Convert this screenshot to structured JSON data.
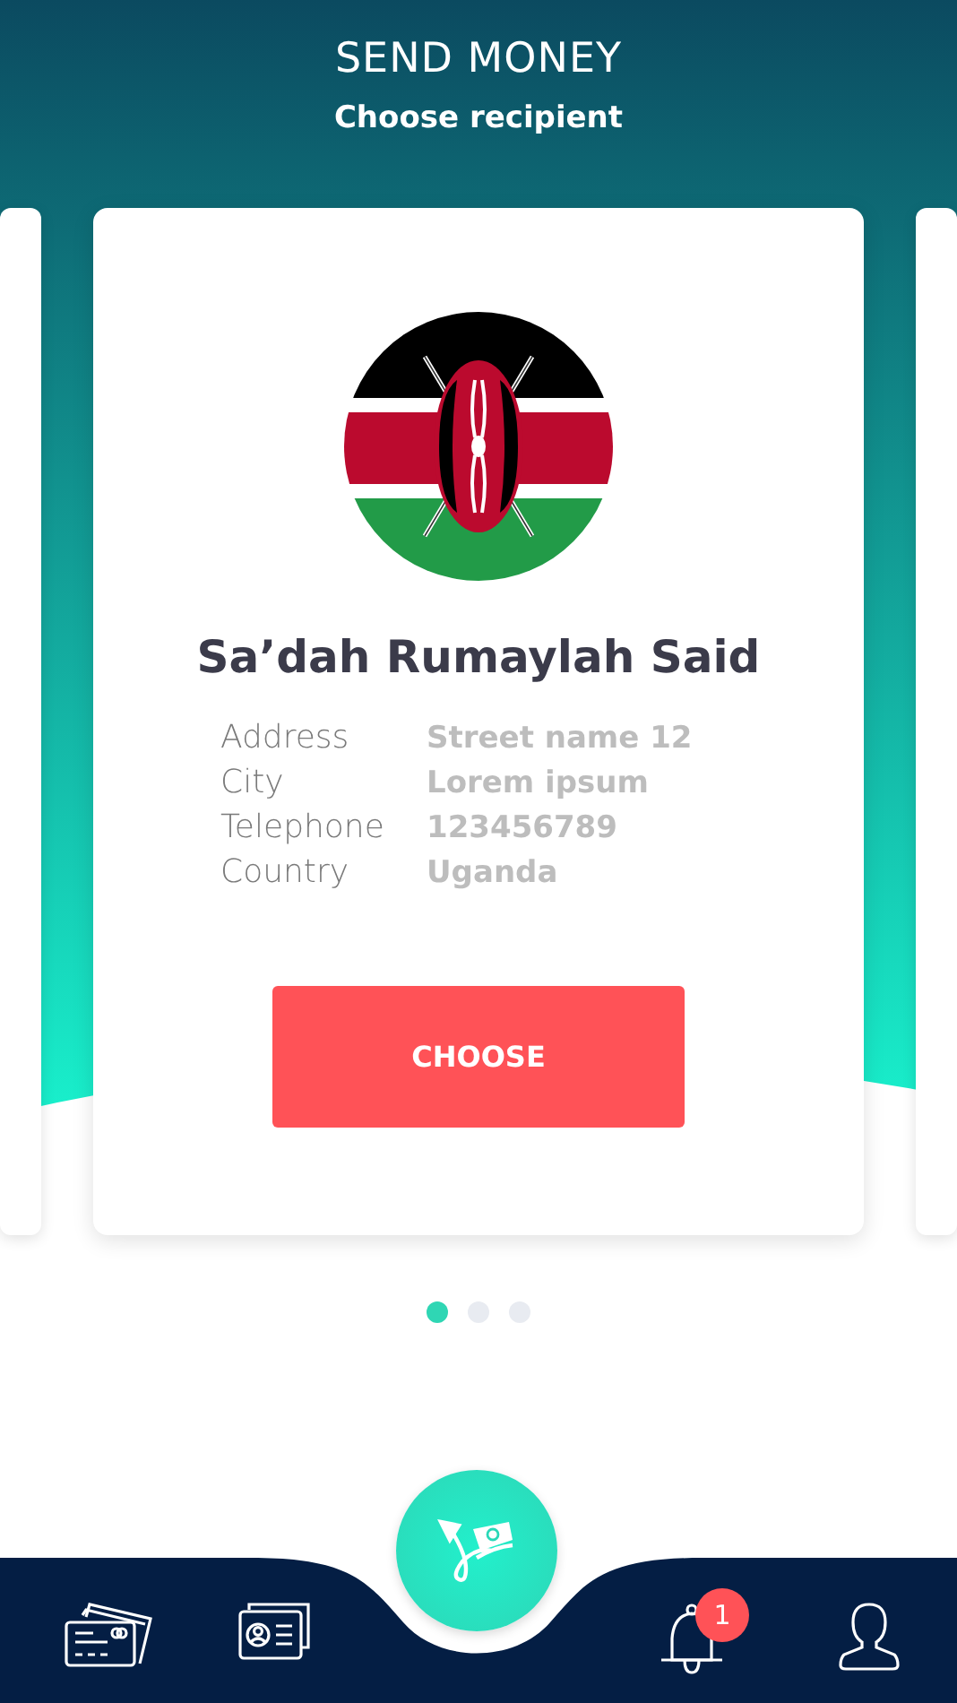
{
  "header": {
    "title": "SEND MONEY",
    "subtitle": "Choose recipient"
  },
  "recipient": {
    "name": "Sa’dah Rumaylah Said",
    "details": [
      {
        "label": "Address",
        "value": "Street name 12"
      },
      {
        "label": "City",
        "value": "Lorem ipsum"
      },
      {
        "label": "Telephone",
        "value": "123456789"
      },
      {
        "label": "Country",
        "value": "Uganda"
      }
    ],
    "button": "CHOOSE"
  },
  "pages": [
    {
      "selected": true
    },
    {
      "selected": false
    },
    {
      "selected": false
    }
  ],
  "nav": [
    {
      "kind": "cards"
    },
    {
      "kind": "id-card"
    },
    {
      "kind": "send"
    },
    {
      "kind": "bell",
      "badge": "1"
    },
    {
      "kind": "profile"
    }
  ]
}
